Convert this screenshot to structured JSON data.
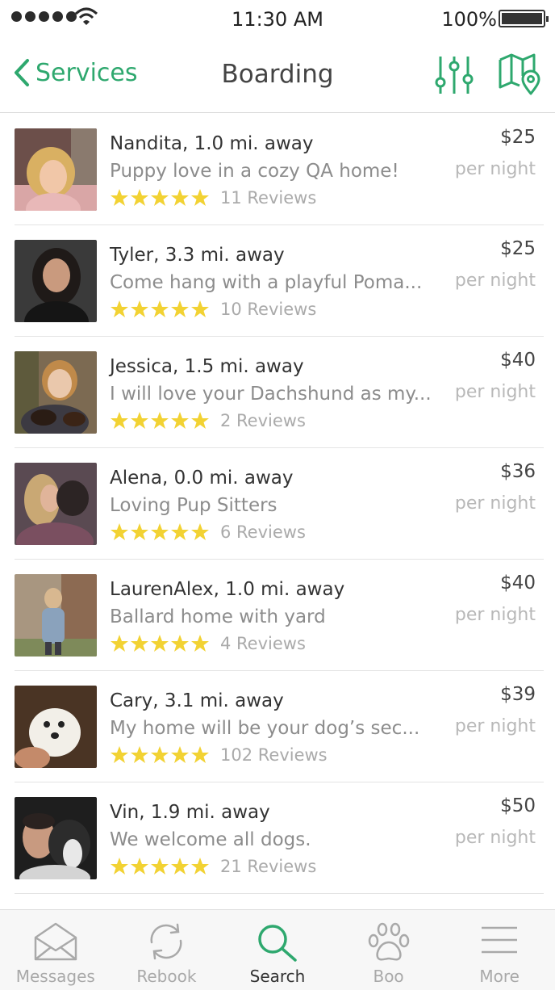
{
  "status": {
    "time": "11:30 AM",
    "battery": "100%"
  },
  "nav": {
    "back_label": "Services",
    "title": "Boarding"
  },
  "colors": {
    "accent": "#2ea86e",
    "star": "#f2d233"
  },
  "listings": [
    {
      "name": "Nandita, 1.0 mi. away",
      "tagline": "Puppy love in a cozy QA home!",
      "reviews": "11 Reviews",
      "price": "$25",
      "per": "per night",
      "rating": 5
    },
    {
      "name": "Tyler, 3.3 mi. away",
      "tagline": "Come hang with a playful Poma...",
      "reviews": "10 Reviews",
      "price": "$25",
      "per": "per night",
      "rating": 5
    },
    {
      "name": "Jessica, 1.5 mi. away",
      "tagline": "I will love your Dachshund as my...",
      "reviews": "2 Reviews",
      "price": "$40",
      "per": "per night",
      "rating": 5
    },
    {
      "name": "Alena, 0.0 mi. away",
      "tagline": "Loving Pup Sitters",
      "reviews": "6 Reviews",
      "price": "$36",
      "per": "per night",
      "rating": 5
    },
    {
      "name": "LaurenAlex, 1.0 mi. away",
      "tagline": "Ballard home with yard",
      "reviews": "4 Reviews",
      "price": "$40",
      "per": "per night",
      "rating": 5
    },
    {
      "name": "Cary, 3.1 mi. away",
      "tagline": "My home will be your dog’s sec...",
      "reviews": "102 Reviews",
      "price": "$39",
      "per": "per night",
      "rating": 5
    },
    {
      "name": "Vin, 1.9 mi. away",
      "tagline": "We welcome all dogs.",
      "reviews": "21 Reviews",
      "price": "$50",
      "per": "per night",
      "rating": 5
    }
  ],
  "tabs": [
    {
      "label": "Messages",
      "icon": "envelope-icon"
    },
    {
      "label": "Rebook",
      "icon": "refresh-icon"
    },
    {
      "label": "Search",
      "icon": "search-icon",
      "active": true
    },
    {
      "label": "Boo",
      "icon": "paw-icon"
    },
    {
      "label": "More",
      "icon": "menu-icon"
    }
  ]
}
